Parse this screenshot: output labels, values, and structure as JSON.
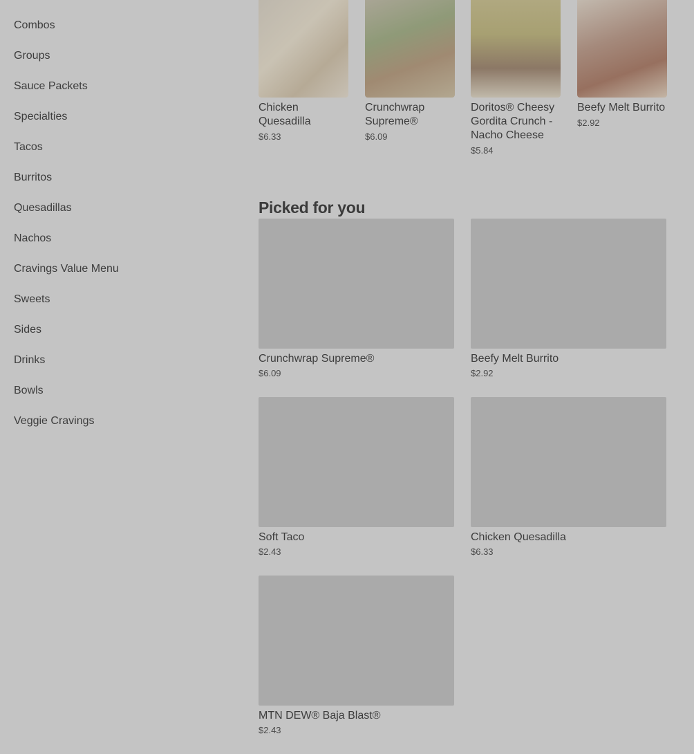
{
  "sidebar": {
    "items": [
      {
        "label": "Combos"
      },
      {
        "label": "Groups"
      },
      {
        "label": "Sauce Packets"
      },
      {
        "label": "Specialties"
      },
      {
        "label": "Tacos"
      },
      {
        "label": "Burritos"
      },
      {
        "label": "Quesadillas"
      },
      {
        "label": "Nachos"
      },
      {
        "label": "Cravings Value Menu"
      },
      {
        "label": "Sweets"
      },
      {
        "label": "Sides"
      },
      {
        "label": "Drinks"
      },
      {
        "label": "Bowls"
      },
      {
        "label": "Veggie Cravings"
      }
    ]
  },
  "top_items": [
    {
      "name": "Chicken Quesadilla",
      "price": "$6.33"
    },
    {
      "name": "Crunchwrap Supreme®",
      "price": "$6.09"
    },
    {
      "name": "Doritos® Cheesy Gordita Crunch - Nacho Cheese",
      "price": "$5.84"
    },
    {
      "name": "Beefy Melt Burrito",
      "price": "$2.92"
    }
  ],
  "picked": {
    "title": "Picked for you",
    "items": [
      {
        "name": "Crunchwrap Supreme®",
        "price": "$6.09"
      },
      {
        "name": "Beefy Melt Burrito",
        "price": "$2.92"
      },
      {
        "name": "Soft Taco",
        "price": "$2.43"
      },
      {
        "name": "Chicken Quesadilla",
        "price": "$6.33"
      },
      {
        "name": "MTN DEW® Baja Blast®",
        "price": "$2.43"
      }
    ]
  }
}
